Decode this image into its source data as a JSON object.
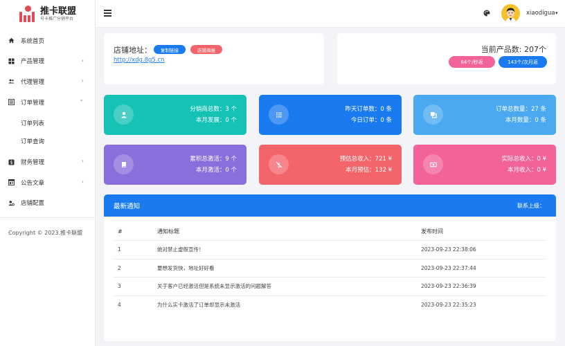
{
  "brand": {
    "title": "推卡联盟",
    "subtitle": "号卡推广分销平台"
  },
  "sidebar": {
    "items": [
      {
        "label": "系统首页",
        "icon": "home-icon"
      },
      {
        "label": "产品管理",
        "icon": "grid-icon",
        "expand": "›"
      },
      {
        "label": "代理管理",
        "icon": "users-icon",
        "expand": "›"
      },
      {
        "label": "订单管理",
        "icon": "list-icon",
        "expand": "⌄"
      },
      {
        "label": "订单列表"
      },
      {
        "label": "订单查询"
      },
      {
        "label": "财务管理",
        "icon": "dollar-icon",
        "expand": "›"
      },
      {
        "label": "公告文章",
        "icon": "article-icon",
        "expand": "›"
      },
      {
        "label": "店铺配置",
        "icon": "user-cog-icon"
      }
    ],
    "copyright": "Copyright © 2023.推卡联盟"
  },
  "header": {
    "username": "xiaodigua",
    "caret": "▾"
  },
  "shop": {
    "label": "店铺地址：",
    "copy_link": "复制链接",
    "poster": "店铺海报",
    "url": "http://xdg.8g5.cn"
  },
  "product": {
    "count_label": "当前产品数: 207个",
    "rate_sec": "64个/秒返",
    "rate_month": "143个/次月返"
  },
  "stats": [
    {
      "l1": "分销商总数：3 个",
      "l2": "本月发展：0 个",
      "color": "#16c2b5"
    },
    {
      "l1": "昨天订单数：0 条",
      "l2": "今日订单：0 条",
      "color": "#1a7bf0"
    },
    {
      "l1": "订单总数量：27 条",
      "l2": "本月数量：0 条",
      "color": "#4aa9f0"
    },
    {
      "l1": "累积总激活：9 个",
      "l2": "本月激活：0 个",
      "color": "#8a6fdc"
    },
    {
      "l1": "预估总收入：721 ¥",
      "l2": "本月预估：132 ¥",
      "color": "#f4656b"
    },
    {
      "l1": "实际总收入：0 ¥",
      "l2": "本月收入：0 ¥",
      "color": "#f4629a"
    }
  ],
  "notice": {
    "title": "最新通知",
    "contact": "联系上级：",
    "headers": [
      "#",
      "通知标题",
      "发布时间"
    ],
    "rows": [
      [
        "1",
        "绝对禁止虚假宣传！",
        "2023-09-23 22:38:06"
      ],
      [
        "2",
        "要想发货快，地址好好看",
        "2023-09-23 22:37:44"
      ],
      [
        "3",
        "关于客户已经激活但是系统未显示激活的问题解答",
        "2023-09-23 22:36:39"
      ],
      [
        "4",
        "为什么实卡激活了订单却显示未激活",
        "2023-09-23 22:35:23"
      ]
    ]
  }
}
